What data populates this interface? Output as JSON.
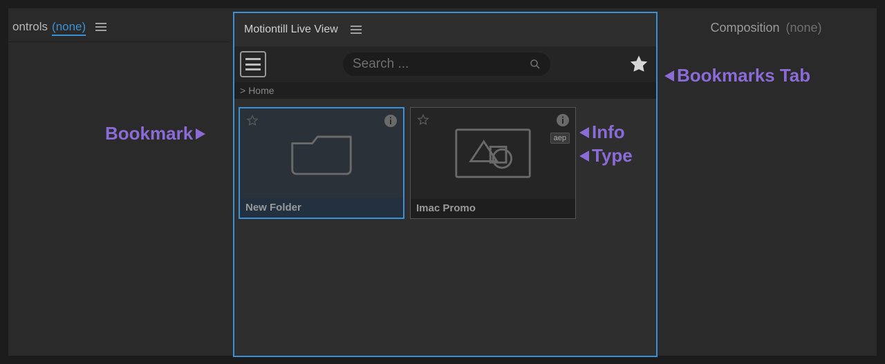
{
  "left_panel": {
    "title_fragment": "ontrols",
    "none_label": "(none)"
  },
  "right_panel": {
    "title": "Composition",
    "none_label": "(none)"
  },
  "center_panel": {
    "title": "Motiontill Live View",
    "search_placeholder": "Search ...",
    "breadcrumb_prefix": ">",
    "breadcrumb_home": "Home"
  },
  "items": [
    {
      "name": "New Folder",
      "kind": "folder",
      "selected": true
    },
    {
      "name": "Imac Promo",
      "kind": "project",
      "type_badge": "aep",
      "selected": false
    }
  ],
  "annotations": {
    "bookmark": "Bookmark",
    "bookmarks_tab": "Bookmarks Tab",
    "info": "Info",
    "type": "Type"
  },
  "colors": {
    "accent": "#3a91d6",
    "annotation": "#8b6bd6"
  }
}
